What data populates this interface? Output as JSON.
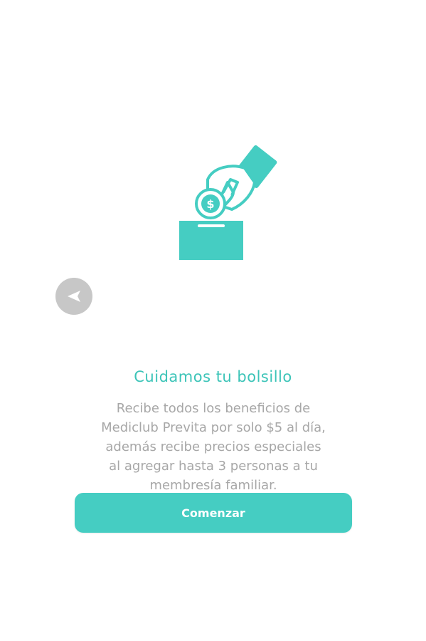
{
  "colors": {
    "accent": "#45cdc2",
    "title": "#3cc4b8",
    "body_text": "#a7a7a7",
    "back_button": "#c7c7c7"
  },
  "illustration": {
    "icon": "hand-dropping-dollar-coin-into-box-icon",
    "coin_symbol": "$"
  },
  "nav": {
    "back_icon": "arrow-left-icon"
  },
  "onboarding": {
    "title": "Cuidamos tu bolsillo",
    "description": "Recibe todos los beneficios de\nMediclub Previta por solo $5 al día,\nademás recibe precios especiales\nal agregar hasta 3 personas a tu\nmembresía familiar.",
    "start_label": "Comenzar"
  }
}
